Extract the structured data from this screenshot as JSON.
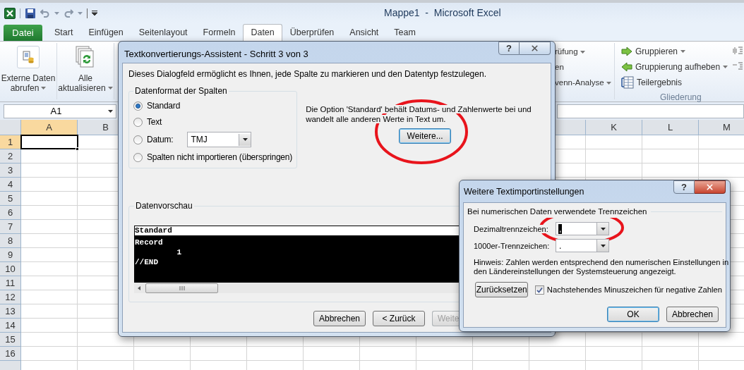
{
  "window": {
    "title": "Mappe1  -  Microsoft Excel"
  },
  "ribbon_tabs": [
    {
      "label": "Datei",
      "kind": "file",
      "selected": false
    },
    {
      "label": "Start",
      "kind": "tab",
      "selected": false
    },
    {
      "label": "Einfügen",
      "kind": "tab",
      "selected": false
    },
    {
      "label": "Seitenlayout",
      "kind": "tab",
      "selected": false
    },
    {
      "label": "Formeln",
      "kind": "tab",
      "selected": false
    },
    {
      "label": "Daten",
      "kind": "tab",
      "selected": true
    },
    {
      "label": "Überprüfen",
      "kind": "tab",
      "selected": false
    },
    {
      "label": "Ansicht",
      "kind": "tab",
      "selected": false
    },
    {
      "label": "Team",
      "kind": "tab",
      "selected": false
    }
  ],
  "ribbon": {
    "large_buttons": [
      {
        "lines": [
          "Externe Daten",
          "abrufen"
        ],
        "dropdown": true
      },
      {
        "lines": [
          "Alle",
          "aktualisieren"
        ],
        "dropdown": true
      }
    ],
    "partial_items": [
      {
        "label": "rüfung",
        "dropdown": true
      },
      {
        "label": "en",
        "dropdown": false
      },
      {
        "label": "venn-Analyse",
        "dropdown": true
      }
    ],
    "outline_group": {
      "label": "Gliederung",
      "items": [
        {
          "label": "Gruppieren",
          "dropdown": true
        },
        {
          "label": "Gruppierung aufheben",
          "dropdown": true
        },
        {
          "label": "Teilergebnis",
          "dropdown": false
        }
      ]
    }
  },
  "name_box": {
    "value": "A1"
  },
  "sheet": {
    "columns": [
      {
        "label": "A",
        "selected": true
      },
      {
        "label": "B",
        "selected": false
      },
      {
        "label": "K",
        "selected": false
      },
      {
        "label": "L",
        "selected": false
      },
      {
        "label": "M",
        "selected": false
      }
    ],
    "rows": [
      {
        "label": "1",
        "selected": true
      },
      {
        "label": "2",
        "selected": false
      },
      {
        "label": "3",
        "selected": false
      },
      {
        "label": "4",
        "selected": false
      },
      {
        "label": "5",
        "selected": false
      },
      {
        "label": "6",
        "selected": false
      },
      {
        "label": "7",
        "selected": false
      },
      {
        "label": "8",
        "selected": false
      },
      {
        "label": "9",
        "selected": false
      },
      {
        "label": "10",
        "selected": false
      },
      {
        "label": "11",
        "selected": false
      },
      {
        "label": "12",
        "selected": false
      },
      {
        "label": "13",
        "selected": false
      },
      {
        "label": "14",
        "selected": false
      },
      {
        "label": "15",
        "selected": false
      },
      {
        "label": "16",
        "selected": false
      }
    ]
  },
  "wizard_dialog": {
    "title": "Textkonvertierungs-Assistent - Schritt 3 von 3",
    "help_button": "?",
    "intro": "Dieses Dialogfeld ermöglicht es Ihnen, jede Spalte zu markieren und den Datentyp festzulegen.",
    "format_group": {
      "legend": "Datenformat der Spalten",
      "options": [
        {
          "label": "Standard",
          "selected": true
        },
        {
          "label": "Text",
          "selected": false
        },
        {
          "label": "Datum:",
          "selected": false,
          "dropdown_value": "TMJ"
        },
        {
          "label": "Spalten nicht importieren (überspringen)",
          "selected": false
        }
      ]
    },
    "hint": "Die Option 'Standard' behält Datums- und Zahlenwerte bei und wandelt alle anderen Werte in Text um.",
    "advanced_button": "Weitere...",
    "preview": {
      "legend": "Datenvorschau",
      "column_header": "Standard",
      "lines": [
        "Record",
        "         1",
        "//END"
      ]
    },
    "buttons": [
      {
        "label": "Abbrechen",
        "disabled": false
      },
      {
        "label": "< Zurück",
        "disabled": false
      },
      {
        "label": "Weite",
        "disabled": true
      }
    ]
  },
  "advanced_dialog": {
    "title": "Weitere Textimportinstellungen",
    "help_button": "?",
    "legend": "Bei numerischen Daten verwendete Trennzeichen",
    "fields": [
      {
        "label": "Dezimaltrennzeichen:",
        "value": ",",
        "highlighted": true
      },
      {
        "label": "1000er-Trennzeichen:",
        "value": ".",
        "highlighted": false
      }
    ],
    "note": "Hinweis: Zahlen werden entsprechend den numerischen Einstellungen in den Ländereinstellungen der Systemsteuerung angezeigt.",
    "reset_button": "Zurücksetzen",
    "checkbox": {
      "label": "Nachstehendes Minuszeichen für negative Zahlen",
      "checked": true
    },
    "buttons": [
      {
        "label": "OK",
        "default": true
      },
      {
        "label": "Abbrechen",
        "default": false
      }
    ]
  }
}
